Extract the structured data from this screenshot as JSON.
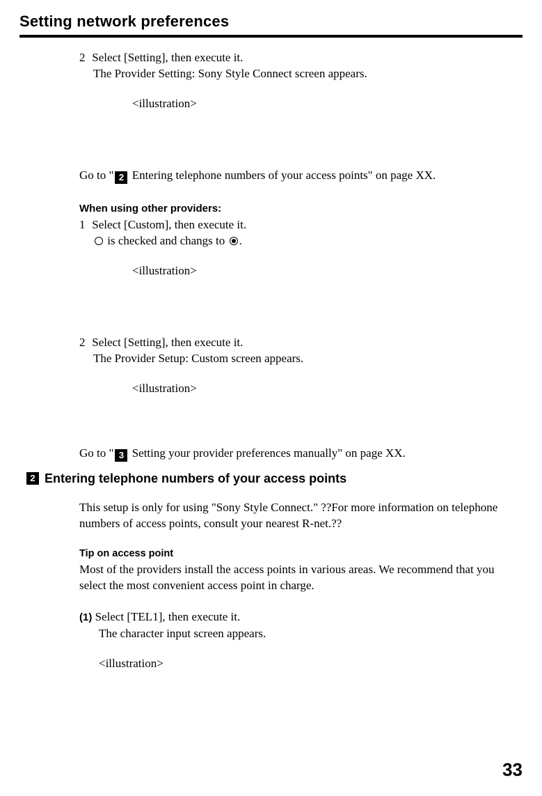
{
  "title": "Setting network preferences",
  "block1": {
    "step2_num": "2",
    "step2_text": "Select [Setting], then execute it.",
    "step2_detail": "The Provider Setting: Sony Style Connect screen appears.",
    "illus": "<illustration>",
    "goto_pre": "Go to \"",
    "goto_badge": "2",
    "goto_post": " Entering telephone numbers of your access points\" on page XX."
  },
  "other": {
    "heading": "When using other providers:",
    "step1_num": "1",
    "step1_text": "Select [Custom], then execute it.",
    "step1_detail_pre": "",
    "step1_detail_mid": " is checked and changs to ",
    "step1_detail_post": ".",
    "illus1": "<illustration>",
    "step2_num": "2",
    "step2_text": "Select [Setting], then execute it.",
    "step2_detail": "The Provider Setup: Custom screen appears.",
    "illus2": "<illustration>",
    "goto_pre": "Go to \"",
    "goto_badge": "3",
    "goto_post": " Setting your provider preferences manually\" on page XX."
  },
  "section2": {
    "badge": "2",
    "title": "Entering telephone numbers of your access points",
    "para": "This setup is only for using \"Sony Style Connect.\" ??For more information on telephone numbers of access points, consult your nearest R-net.??",
    "tip_head": "Tip on access point",
    "tip_body": "Most of the providers install the access points in various areas. We recommend that you select the most convenient access point in charge.",
    "step1_label": "(1)",
    "step1_text": " Select [TEL1], then execute it.",
    "step1_detail": "The character input screen appears.",
    "illus": "<illustration>"
  },
  "page_number": "33"
}
